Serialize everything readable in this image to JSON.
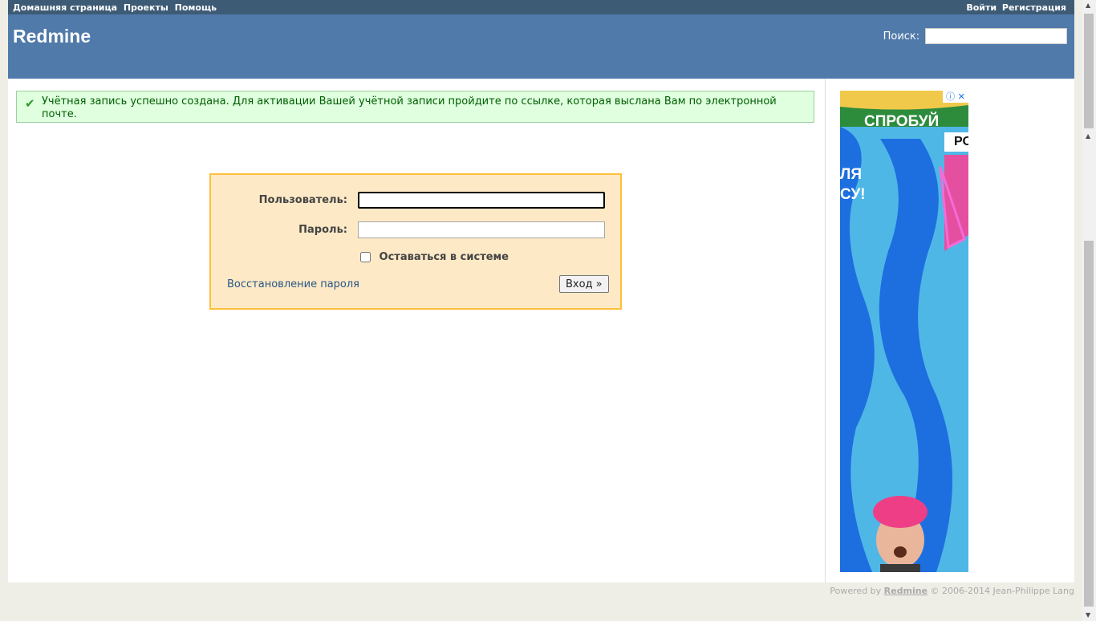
{
  "top_menu": {
    "left": [
      "Домашняя страница",
      "Проекты",
      "Помощь"
    ],
    "right": [
      "Войти",
      "Регистрация"
    ]
  },
  "header": {
    "title": "Redmine",
    "search_label": "Поиск:",
    "search_value": ""
  },
  "flash": {
    "icon": "check-icon",
    "message": "Учётная запись успешно создана. Для активации Вашей учётной записи пройдите по ссылке, которая выслана Вам по электронной почте."
  },
  "login": {
    "username_label": "Пользователь:",
    "username_value": "",
    "password_label": "Пароль:",
    "password_value": "",
    "remember_label": "Оставаться в системе",
    "lost_password_link": "Восстановление пароля",
    "submit_label": "Вход »"
  },
  "ad": {
    "text_1": "СПРОБУЙ",
    "text_2": "РО",
    "text_3_line1": "ЛЯ",
    "text_3_line2": "СУ!",
    "info_icon": "ⓘ",
    "close_icon": "✕"
  },
  "footer": {
    "prefix": "Powered by",
    "link": "Redmine",
    "suffix": "© 2006-2014 Jean-Philippe Lang"
  },
  "colors": {
    "top_menu_bg": "#3e5b76",
    "header_bg": "#507aaa",
    "flash_bg": "#dfffdf",
    "login_bg": "#fde9c6",
    "login_border": "#fdbf3b"
  }
}
